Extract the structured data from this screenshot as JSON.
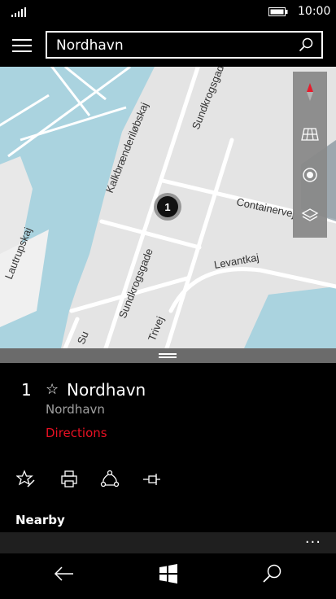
{
  "status": {
    "time": "10:00"
  },
  "search": {
    "value": "Nordhavn"
  },
  "map": {
    "pin_label": "1",
    "streets": [
      "Kalkbrænderiløbskaj",
      "Sundkrogsgade",
      "Containervej",
      "Levantkaj",
      "Lautrupskaj",
      "Sundkrogsgade",
      "Trivej",
      "Su"
    ]
  },
  "result": {
    "number": "1",
    "title": "Nordhavn",
    "subtitle": "Nordhavn",
    "directions_label": "Directions"
  },
  "nearby_label": "Nearby",
  "more_label": "..."
}
